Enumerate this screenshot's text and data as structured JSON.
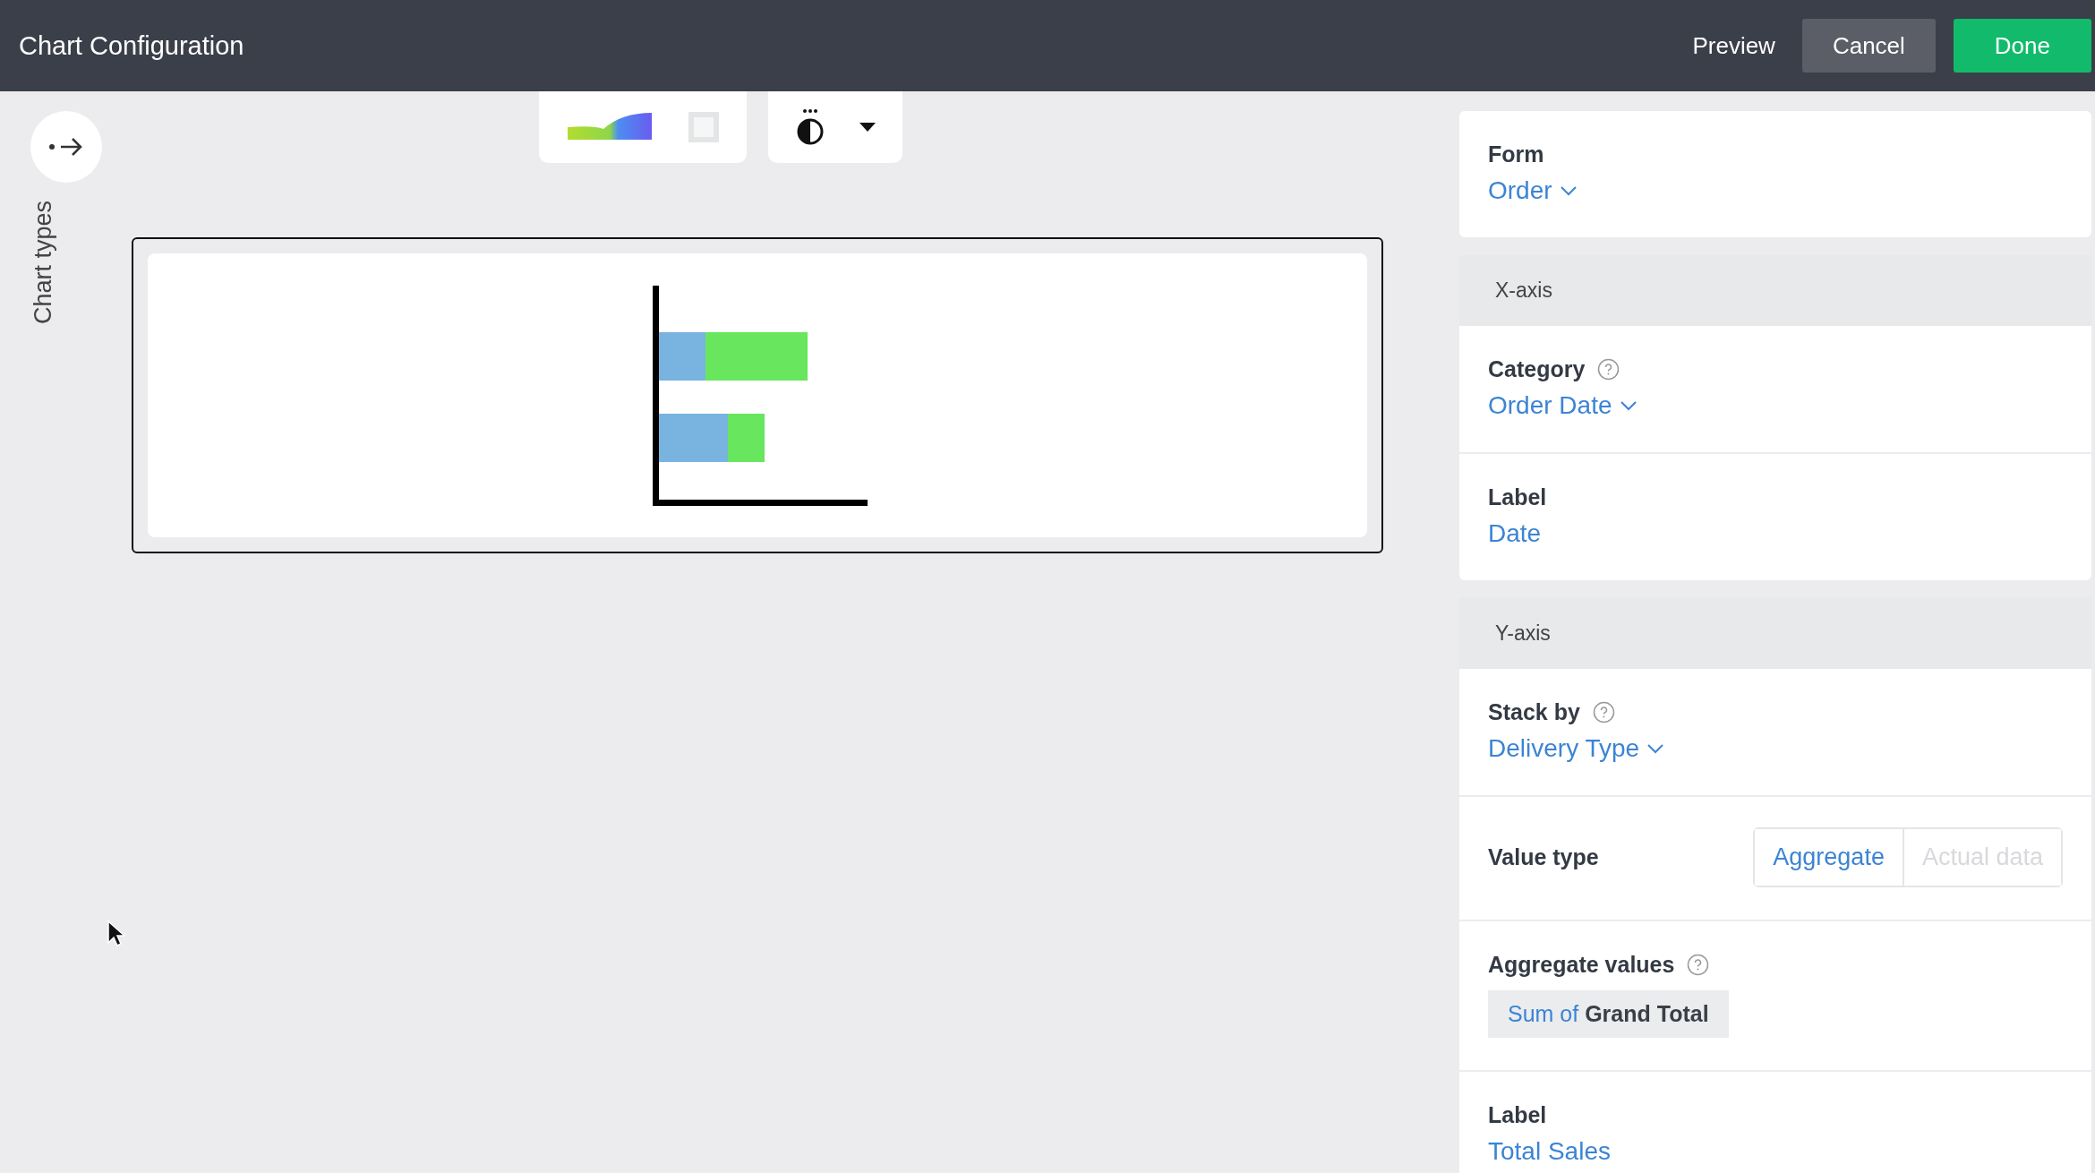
{
  "header": {
    "title": "Chart Configuration",
    "buttons": [
      {
        "label": "Preview",
        "kind": "text"
      },
      {
        "label": "Cancel",
        "kind": "secondary"
      },
      {
        "label": "Done",
        "kind": "primary"
      }
    ]
  },
  "sidebar": {
    "label": "Chart types"
  },
  "panel": {
    "sections": [
      {
        "fields": [
          {
            "kind": "dropdown",
            "label": "Form",
            "value": "Order",
            "help": false
          }
        ]
      },
      {
        "title": "X-axis",
        "fields": [
          {
            "kind": "dropdown",
            "label": "Category",
            "value": "Order Date",
            "help": true
          },
          {
            "kind": "text",
            "label": "Label",
            "value": "Date",
            "help": false
          }
        ]
      },
      {
        "title": "Y-axis",
        "fields": [
          {
            "kind": "dropdown",
            "label": "Stack by",
            "value": "Delivery Type",
            "help": true
          },
          {
            "kind": "toggle",
            "label": "Value type",
            "help": false,
            "options": [
              {
                "label": "Aggregate",
                "selected": true
              },
              {
                "label": "Actual data",
                "selected": false
              }
            ]
          },
          {
            "kind": "chip",
            "label": "Aggregate values",
            "value": "Sum of **Grand Total**",
            "help": true
          },
          {
            "kind": "text",
            "label": "Label",
            "value": "Total Sales",
            "help": false
          }
        ]
      }
    ]
  }
}
